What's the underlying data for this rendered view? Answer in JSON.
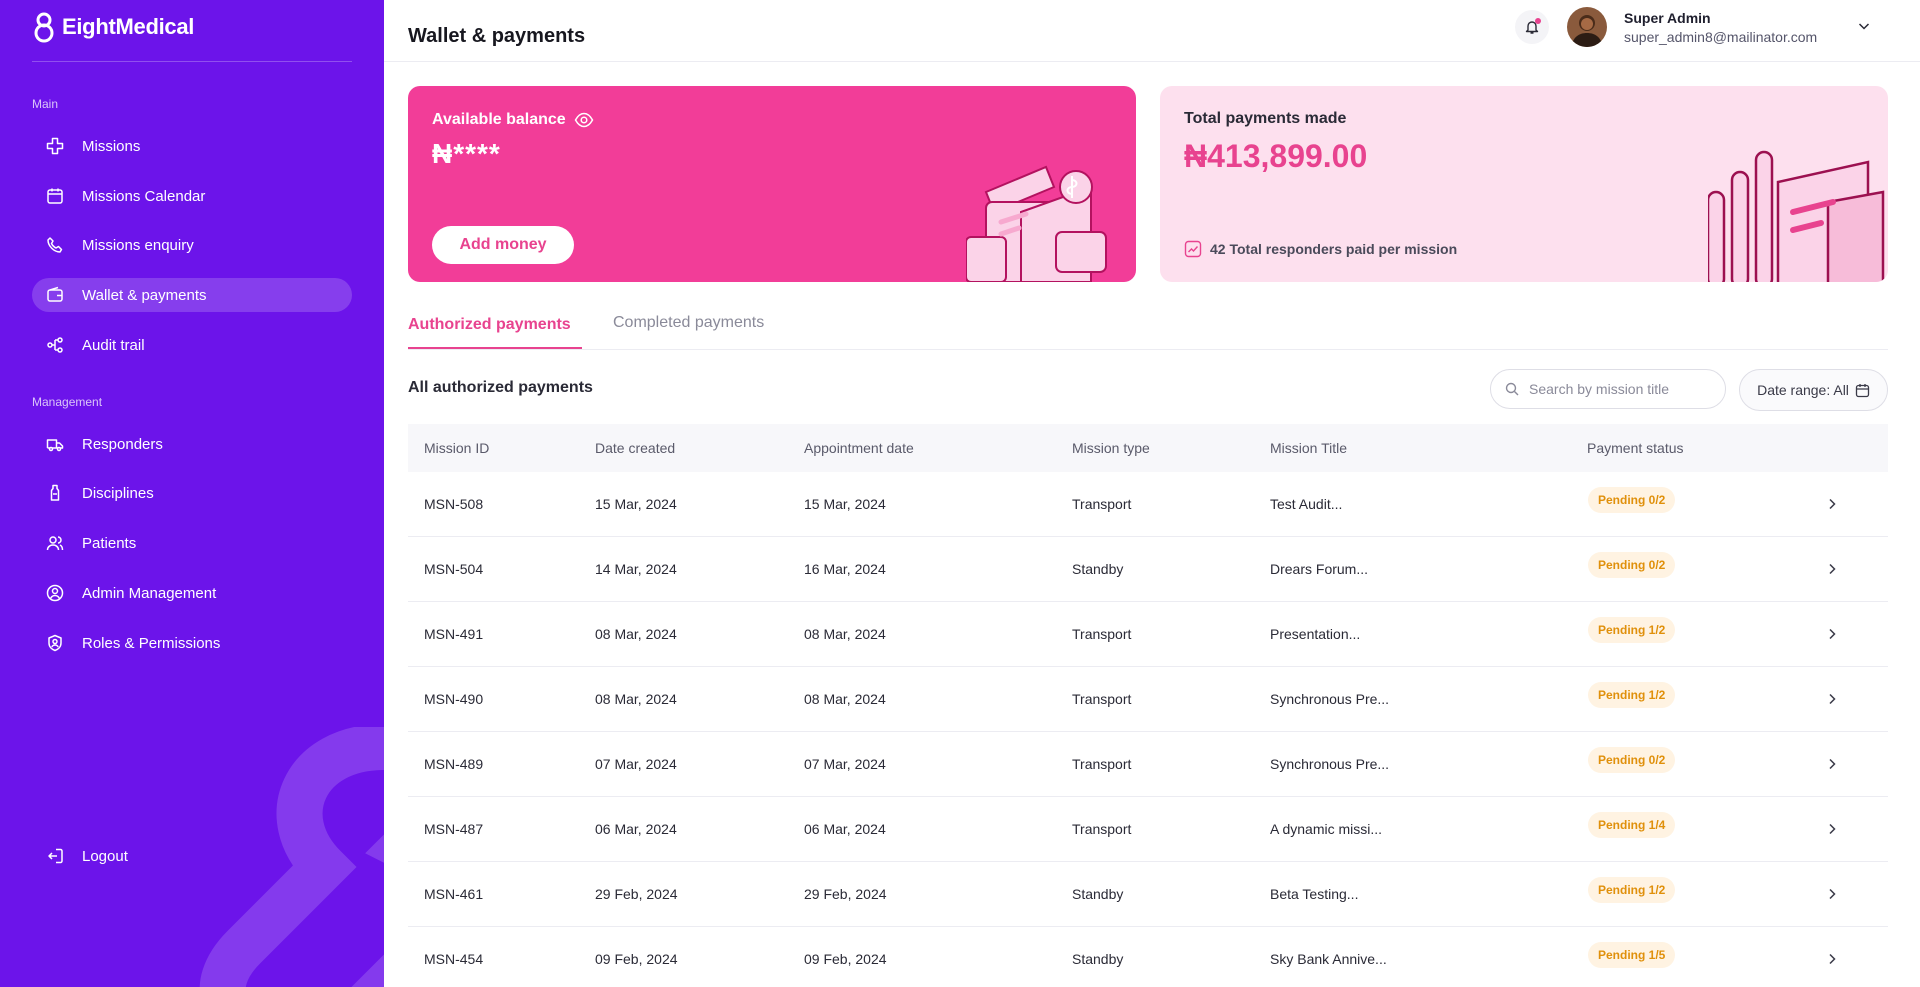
{
  "brand": {
    "name": "EightMedical"
  },
  "sidebar": {
    "section_main": "Main",
    "section_management": "Management",
    "main_items": [
      {
        "label": "Missions",
        "icon": "cross-icon"
      },
      {
        "label": "Missions Calendar",
        "icon": "calendar-icon"
      },
      {
        "label": "Missions enquiry",
        "icon": "phone-icon"
      },
      {
        "label": "Wallet & payments",
        "icon": "wallet-icon",
        "active": true
      },
      {
        "label": "Audit trail",
        "icon": "tree-icon"
      }
    ],
    "management_items": [
      {
        "label": "Responders",
        "icon": "ambulance-icon"
      },
      {
        "label": "Disciplines",
        "icon": "bottle-icon"
      },
      {
        "label": "Patients",
        "icon": "users-icon"
      },
      {
        "label": "Admin Management",
        "icon": "user-circle-icon"
      },
      {
        "label": "Roles & Permissions",
        "icon": "shield-user-icon"
      }
    ],
    "logout": "Logout"
  },
  "header": {
    "title": "Wallet & payments",
    "user_name": "Super Admin",
    "user_email": "super_admin8@mailinator.com"
  },
  "cards": {
    "balance_label": "Available balance",
    "balance_value": "₦****",
    "add_money": "Add money",
    "total_label": "Total payments made",
    "total_value": "₦413,899.00",
    "total_sub": "42 Total responders paid per mission"
  },
  "tabs": {
    "authorized": "Authorized payments",
    "completed": "Completed payments"
  },
  "list": {
    "title": "All authorized payments",
    "search_placeholder": "Search by mission title",
    "date_range": "Date range: All"
  },
  "table": {
    "headers": [
      "Mission ID",
      "Date created",
      "Appointment date",
      "Mission type",
      "Mission Title",
      "Payment status"
    ],
    "rows": [
      {
        "id": "MSN-508",
        "created": "15 Mar, 2024",
        "appointment": "15 Mar, 2024",
        "type": "Transport",
        "title": "Test Audit...",
        "status": "Pending 0/2"
      },
      {
        "id": "MSN-504",
        "created": "14 Mar, 2024",
        "appointment": "16 Mar, 2024",
        "type": "Standby",
        "title": "Drears Forum...",
        "status": "Pending 0/2"
      },
      {
        "id": "MSN-491",
        "created": "08 Mar, 2024",
        "appointment": "08 Mar, 2024",
        "type": "Transport",
        "title": "Presentation...",
        "status": "Pending 1/2"
      },
      {
        "id": "MSN-490",
        "created": "08 Mar, 2024",
        "appointment": "08 Mar, 2024",
        "type": "Transport",
        "title": "Synchronous Pre...",
        "status": "Pending 1/2"
      },
      {
        "id": "MSN-489",
        "created": "07 Mar, 2024",
        "appointment": "07 Mar, 2024",
        "type": "Transport",
        "title": "Synchronous Pre...",
        "status": "Pending 0/2"
      },
      {
        "id": "MSN-487",
        "created": "06 Mar, 2024",
        "appointment": "06 Mar, 2024",
        "type": "Transport",
        "title": "A dynamic missi...",
        "status": "Pending 1/4"
      },
      {
        "id": "MSN-461",
        "created": "29 Feb, 2024",
        "appointment": "29 Feb, 2024",
        "type": "Standby",
        "title": "Beta Testing...",
        "status": "Pending 1/2"
      },
      {
        "id": "MSN-454",
        "created": "09 Feb, 2024",
        "appointment": "09 Feb, 2024",
        "type": "Standby",
        "title": "Sky Bank Annive...",
        "status": "Pending 1/5"
      }
    ]
  },
  "colors": {
    "sidebar": "#6c14ea",
    "accent": "#e8438f",
    "balance_card": "#f23d98",
    "total_card": "#fde0ee",
    "pending_text": "#e0900b",
    "pending_bg": "#fff3e2"
  }
}
